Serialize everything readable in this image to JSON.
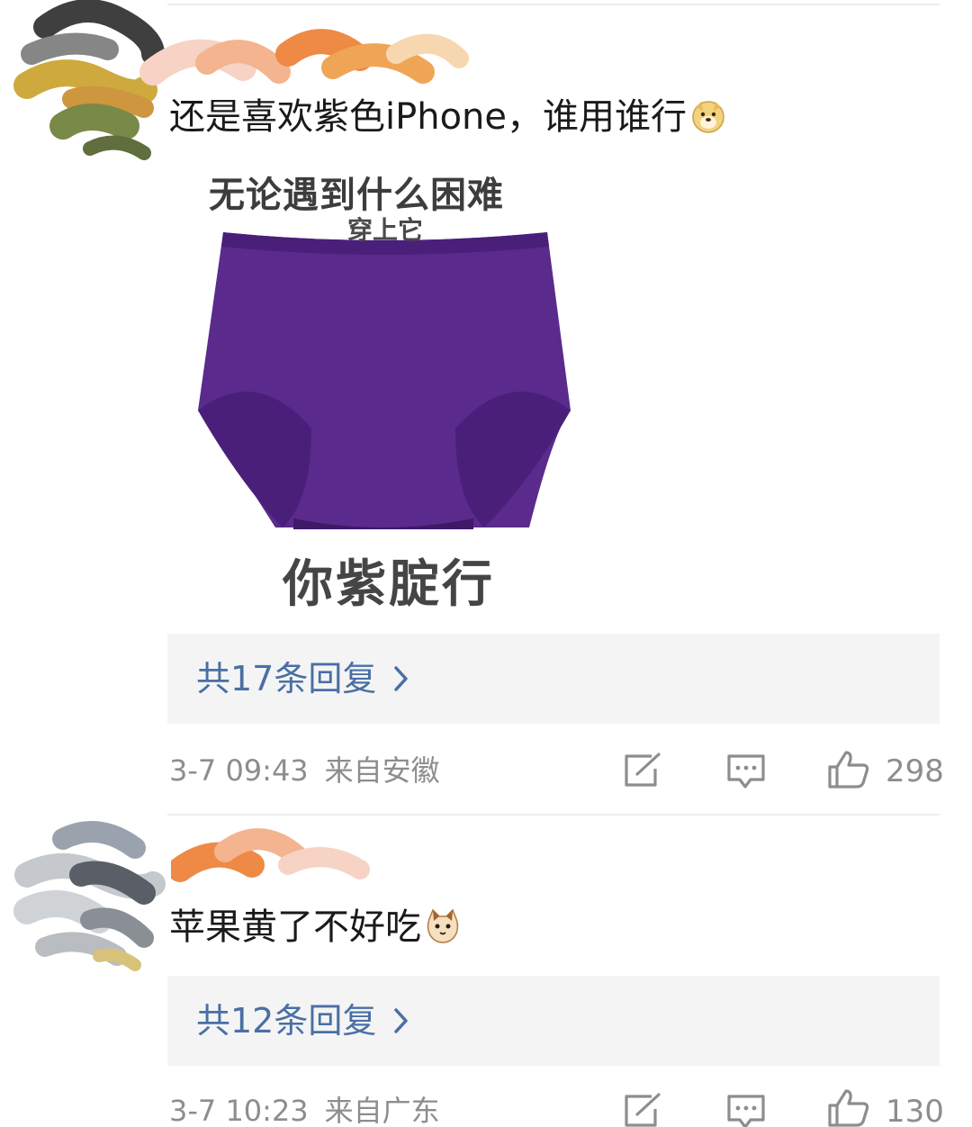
{
  "comments": [
    {
      "text": "还是喜欢紫色iPhone，谁用谁行",
      "emoji_icon": "doge-emoji-icon",
      "meme": {
        "top_text": "无论遇到什么困难",
        "sub_text": "穿上它",
        "bottom_text": "你紫腚行",
        "garment_color": "#5a2a8c"
      },
      "replies_label": "共17条回复",
      "timestamp": "3-7 09:43",
      "location": "来自安徽",
      "likes": "298"
    },
    {
      "text": "苹果黄了不好吃",
      "emoji_icon": "cat-emoji-icon",
      "replies_label": "共12条回复",
      "timestamp": "3-7 10:23",
      "location": "来自广东",
      "likes": "130"
    }
  ],
  "colors": {
    "reply_link": "#4a6fa5",
    "meta_text": "#8d8d8d",
    "reply_box_bg": "#f4f4f4"
  }
}
